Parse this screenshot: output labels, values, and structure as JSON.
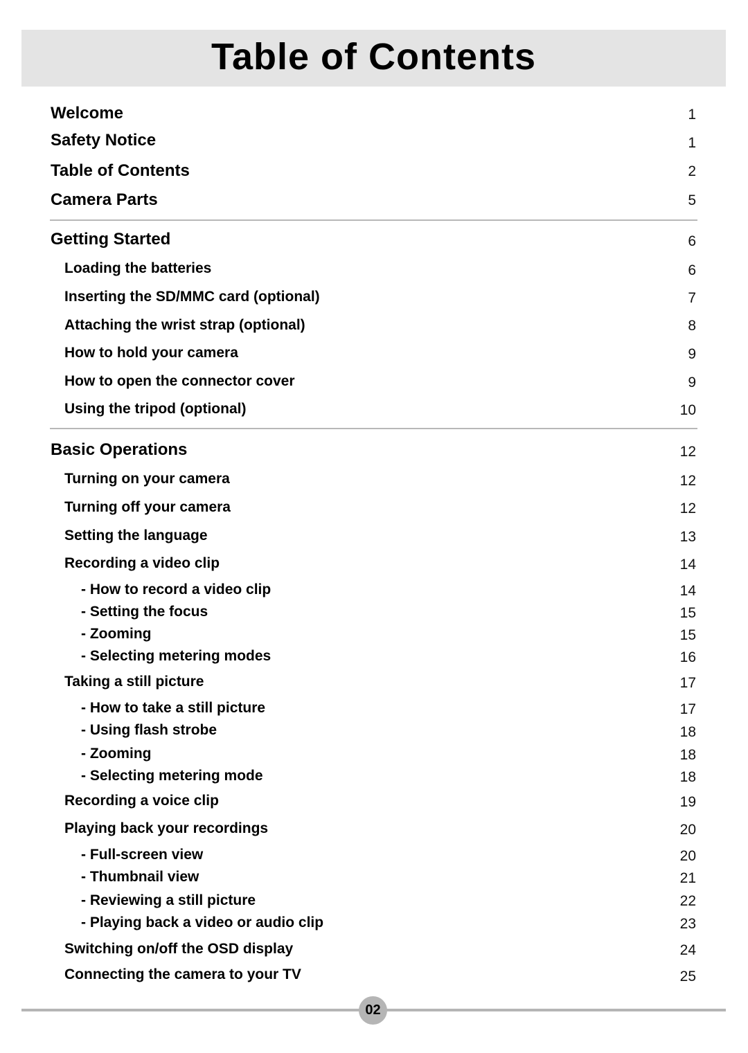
{
  "header": {
    "title": "Table of Contents"
  },
  "toc": {
    "front": [
      {
        "label": "Welcome",
        "page": "1"
      },
      {
        "label": "Safety Notice",
        "page": "1"
      },
      {
        "label": "Table of Contents",
        "page": "2"
      },
      {
        "label": "Camera Parts",
        "page": "5"
      }
    ],
    "getting_started": {
      "label": "Getting Started",
      "page": "6",
      "items": [
        {
          "label": "Loading the batteries",
          "page": "6"
        },
        {
          "label": "Inserting the SD/MMC card (optional)",
          "page": "7"
        },
        {
          "label": "Attaching the wrist strap (optional)",
          "page": "8"
        },
        {
          "label": "How to hold your camera",
          "page": "9"
        },
        {
          "label": "How to open the connector cover",
          "page": "9"
        },
        {
          "label": "Using the tripod (optional)",
          "page": "10"
        }
      ]
    },
    "basic_operations": {
      "label": "Basic Operations",
      "page": "12",
      "items": [
        {
          "label": "Turning on your camera",
          "page": "12"
        },
        {
          "label": "Turning off your camera",
          "page": "12"
        },
        {
          "label": "Setting the language",
          "page": "13"
        },
        {
          "label": "Recording a video clip",
          "page": "14",
          "subitems": [
            {
              "label": "- How to record a video clip",
              "page": "14"
            },
            {
              "label": "- Setting the focus",
              "page": "15"
            },
            {
              "label": "- Zooming",
              "page": "15"
            },
            {
              "label": "- Selecting metering modes",
              "page": "16"
            }
          ]
        },
        {
          "label": "Taking a still picture",
          "page": "17",
          "subitems": [
            {
              "label": "- How to take a still picture",
              "page": "17"
            },
            {
              "label": "- Using flash strobe",
              "page": "18"
            },
            {
              "label": "- Zooming",
              "page": "18"
            },
            {
              "label": "- Selecting metering mode",
              "page": "18"
            }
          ]
        },
        {
          "label": "Recording a voice clip",
          "page": "19"
        },
        {
          "label": "Playing back your recordings",
          "page": "20",
          "subitems": [
            {
              "label": "- Full-screen view",
              "page": "20"
            },
            {
              "label": "- Thumbnail view",
              "page": "21"
            },
            {
              "label": "- Reviewing a still picture",
              "page": "22"
            },
            {
              "label": "- Playing back a video or audio clip",
              "page": "23"
            }
          ]
        },
        {
          "label": "Switching on/off the OSD display",
          "page": "24"
        },
        {
          "label": "Connecting the camera to your TV",
          "page": "25"
        }
      ]
    }
  },
  "footer": {
    "page_number": "02"
  }
}
